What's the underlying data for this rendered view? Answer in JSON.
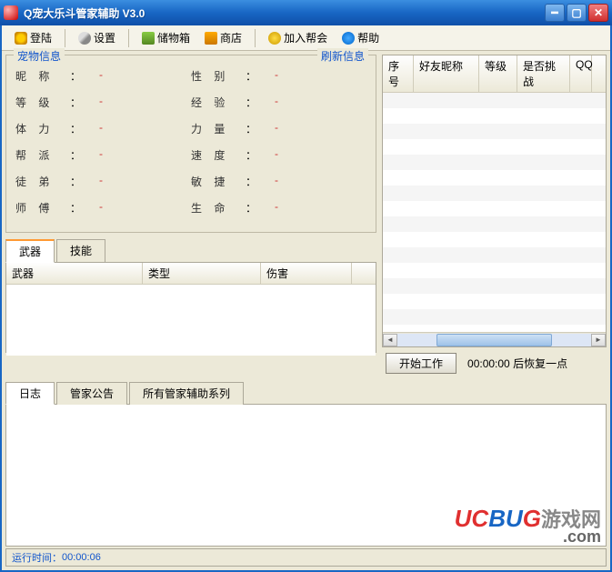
{
  "title": "Q宠大乐斗管家辅助  V3.0",
  "toolbar": {
    "login": "登陆",
    "setting": "设置",
    "storage": "储物箱",
    "shop": "商店",
    "join": "加入帮会",
    "help": "帮助"
  },
  "petInfo": {
    "legend": "宠物信息",
    "refresh": "刷新信息",
    "rows": [
      {
        "l1": "昵",
        "l2": "称",
        "v1": "-",
        "r1": "性",
        "r2": "别",
        "v2": "-"
      },
      {
        "l1": "等",
        "l2": "级",
        "v1": "-",
        "r1": "经",
        "r2": "验",
        "v2": "-"
      },
      {
        "l1": "体",
        "l2": "力",
        "v1": "-",
        "r1": "力",
        "r2": "量",
        "v2": "-"
      },
      {
        "l1": "帮",
        "l2": "派",
        "v1": "-",
        "r1": "速",
        "r2": "度",
        "v2": "-"
      },
      {
        "l1": "徒",
        "l2": "弟",
        "v1": "-",
        "r1": "敏",
        "r2": "捷",
        "v2": "-"
      },
      {
        "l1": "师",
        "l2": "傅",
        "v1": "-",
        "r1": "生",
        "r2": "命",
        "v2": "-"
      }
    ]
  },
  "weaponTabs": {
    "weapon": "武器",
    "skill": "技能"
  },
  "weaponCols": {
    "c1": "武器",
    "c2": "类型",
    "c3": "伤害"
  },
  "friendCols": {
    "c1": "序号",
    "c2": "好友昵称",
    "c3": "等级",
    "c4": "是否挑战",
    "c5": "QQ"
  },
  "action": {
    "start": "开始工作",
    "timer": "00:00:00",
    "timerSuffix": "后恢复一点"
  },
  "logTabs": {
    "log": "日志",
    "notice": "管家公告",
    "all": "所有管家辅助系列"
  },
  "status": {
    "prefix": "运行时间：",
    "time": "00:00:06"
  },
  "watermark": {
    "brand_u": "U",
    "brand_c": "C",
    "brand_b": "B",
    "brand_ug": "U",
    "brand_g": "G",
    "cn": "游戏网",
    "com": ".com"
  }
}
